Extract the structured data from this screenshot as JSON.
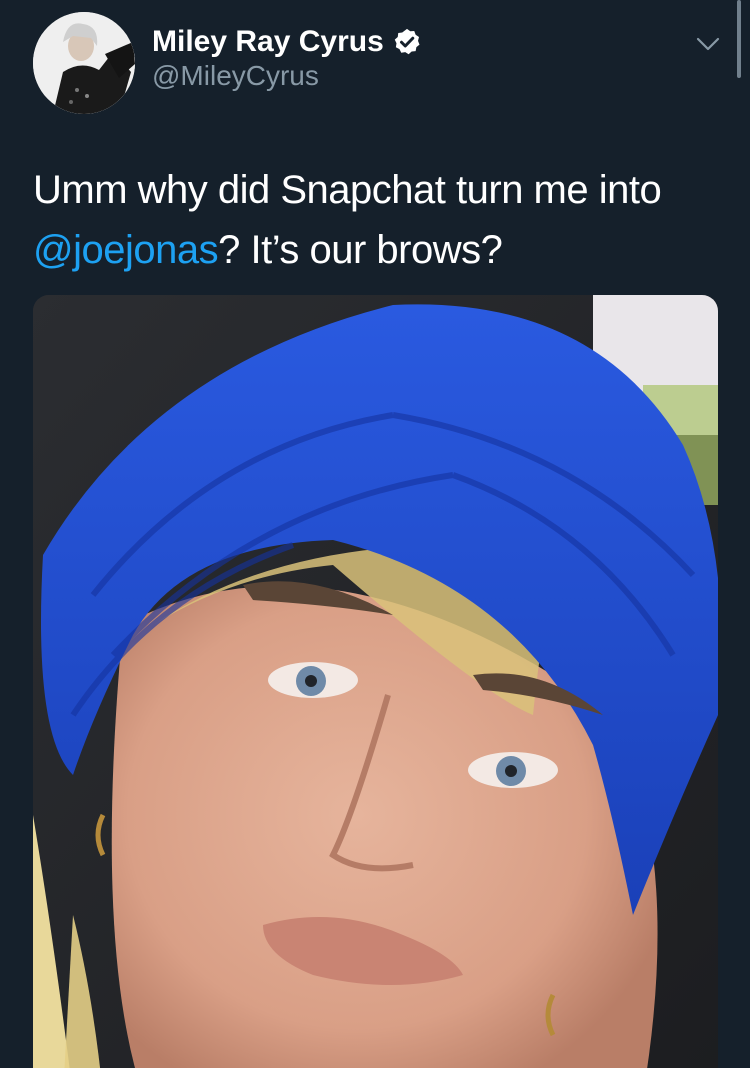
{
  "tweet": {
    "author": {
      "display_name": "Miley Ray Cyrus",
      "handle": "@MileyCyrus",
      "verified": true
    },
    "text": {
      "line1": "Umm why did Snapchat turn me into",
      "mention": "@joejonas",
      "after_mention": "? It’s our brows?"
    },
    "media": {
      "type": "photo"
    }
  },
  "icons": {
    "verified": "verified-badge-icon",
    "more": "chevron-down-icon"
  },
  "colors": {
    "background": "#15202b",
    "text": "#ffffff",
    "secondary": "#8899a6",
    "link": "#1da1f2",
    "hat": "#1c49c9"
  }
}
